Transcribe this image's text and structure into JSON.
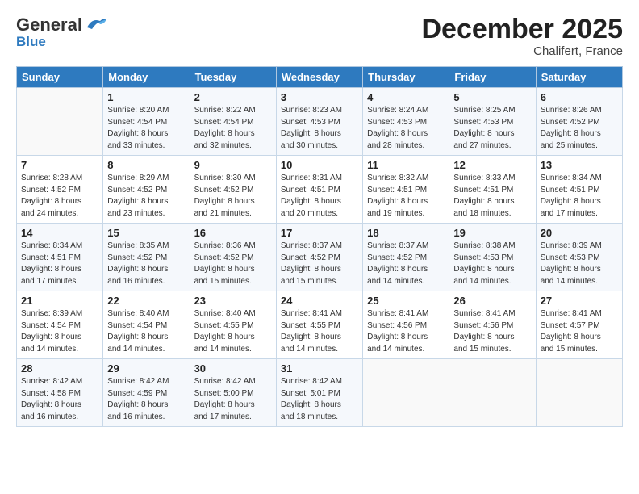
{
  "header": {
    "logo_line1": "General",
    "logo_line2": "Blue",
    "title": "December 2025",
    "subtitle": "Chalifert, France"
  },
  "days_of_week": [
    "Sunday",
    "Monday",
    "Tuesday",
    "Wednesday",
    "Thursday",
    "Friday",
    "Saturday"
  ],
  "weeks": [
    [
      {
        "num": "",
        "sunrise": "",
        "sunset": "",
        "daylight": ""
      },
      {
        "num": "1",
        "sunrise": "Sunrise: 8:20 AM",
        "sunset": "Sunset: 4:54 PM",
        "daylight": "Daylight: 8 hours and 33 minutes."
      },
      {
        "num": "2",
        "sunrise": "Sunrise: 8:22 AM",
        "sunset": "Sunset: 4:54 PM",
        "daylight": "Daylight: 8 hours and 32 minutes."
      },
      {
        "num": "3",
        "sunrise": "Sunrise: 8:23 AM",
        "sunset": "Sunset: 4:53 PM",
        "daylight": "Daylight: 8 hours and 30 minutes."
      },
      {
        "num": "4",
        "sunrise": "Sunrise: 8:24 AM",
        "sunset": "Sunset: 4:53 PM",
        "daylight": "Daylight: 8 hours and 28 minutes."
      },
      {
        "num": "5",
        "sunrise": "Sunrise: 8:25 AM",
        "sunset": "Sunset: 4:53 PM",
        "daylight": "Daylight: 8 hours and 27 minutes."
      },
      {
        "num": "6",
        "sunrise": "Sunrise: 8:26 AM",
        "sunset": "Sunset: 4:52 PM",
        "daylight": "Daylight: 8 hours and 25 minutes."
      }
    ],
    [
      {
        "num": "7",
        "sunrise": "Sunrise: 8:28 AM",
        "sunset": "Sunset: 4:52 PM",
        "daylight": "Daylight: 8 hours and 24 minutes."
      },
      {
        "num": "8",
        "sunrise": "Sunrise: 8:29 AM",
        "sunset": "Sunset: 4:52 PM",
        "daylight": "Daylight: 8 hours and 23 minutes."
      },
      {
        "num": "9",
        "sunrise": "Sunrise: 8:30 AM",
        "sunset": "Sunset: 4:52 PM",
        "daylight": "Daylight: 8 hours and 21 minutes."
      },
      {
        "num": "10",
        "sunrise": "Sunrise: 8:31 AM",
        "sunset": "Sunset: 4:51 PM",
        "daylight": "Daylight: 8 hours and 20 minutes."
      },
      {
        "num": "11",
        "sunrise": "Sunrise: 8:32 AM",
        "sunset": "Sunset: 4:51 PM",
        "daylight": "Daylight: 8 hours and 19 minutes."
      },
      {
        "num": "12",
        "sunrise": "Sunrise: 8:33 AM",
        "sunset": "Sunset: 4:51 PM",
        "daylight": "Daylight: 8 hours and 18 minutes."
      },
      {
        "num": "13",
        "sunrise": "Sunrise: 8:34 AM",
        "sunset": "Sunset: 4:51 PM",
        "daylight": "Daylight: 8 hours and 17 minutes."
      }
    ],
    [
      {
        "num": "14",
        "sunrise": "Sunrise: 8:34 AM",
        "sunset": "Sunset: 4:51 PM",
        "daylight": "Daylight: 8 hours and 17 minutes."
      },
      {
        "num": "15",
        "sunrise": "Sunrise: 8:35 AM",
        "sunset": "Sunset: 4:52 PM",
        "daylight": "Daylight: 8 hours and 16 minutes."
      },
      {
        "num": "16",
        "sunrise": "Sunrise: 8:36 AM",
        "sunset": "Sunset: 4:52 PM",
        "daylight": "Daylight: 8 hours and 15 minutes."
      },
      {
        "num": "17",
        "sunrise": "Sunrise: 8:37 AM",
        "sunset": "Sunset: 4:52 PM",
        "daylight": "Daylight: 8 hours and 15 minutes."
      },
      {
        "num": "18",
        "sunrise": "Sunrise: 8:37 AM",
        "sunset": "Sunset: 4:52 PM",
        "daylight": "Daylight: 8 hours and 14 minutes."
      },
      {
        "num": "19",
        "sunrise": "Sunrise: 8:38 AM",
        "sunset": "Sunset: 4:53 PM",
        "daylight": "Daylight: 8 hours and 14 minutes."
      },
      {
        "num": "20",
        "sunrise": "Sunrise: 8:39 AM",
        "sunset": "Sunset: 4:53 PM",
        "daylight": "Daylight: 8 hours and 14 minutes."
      }
    ],
    [
      {
        "num": "21",
        "sunrise": "Sunrise: 8:39 AM",
        "sunset": "Sunset: 4:54 PM",
        "daylight": "Daylight: 8 hours and 14 minutes."
      },
      {
        "num": "22",
        "sunrise": "Sunrise: 8:40 AM",
        "sunset": "Sunset: 4:54 PM",
        "daylight": "Daylight: 8 hours and 14 minutes."
      },
      {
        "num": "23",
        "sunrise": "Sunrise: 8:40 AM",
        "sunset": "Sunset: 4:55 PM",
        "daylight": "Daylight: 8 hours and 14 minutes."
      },
      {
        "num": "24",
        "sunrise": "Sunrise: 8:41 AM",
        "sunset": "Sunset: 4:55 PM",
        "daylight": "Daylight: 8 hours and 14 minutes."
      },
      {
        "num": "25",
        "sunrise": "Sunrise: 8:41 AM",
        "sunset": "Sunset: 4:56 PM",
        "daylight": "Daylight: 8 hours and 14 minutes."
      },
      {
        "num": "26",
        "sunrise": "Sunrise: 8:41 AM",
        "sunset": "Sunset: 4:56 PM",
        "daylight": "Daylight: 8 hours and 15 minutes."
      },
      {
        "num": "27",
        "sunrise": "Sunrise: 8:41 AM",
        "sunset": "Sunset: 4:57 PM",
        "daylight": "Daylight: 8 hours and 15 minutes."
      }
    ],
    [
      {
        "num": "28",
        "sunrise": "Sunrise: 8:42 AM",
        "sunset": "Sunset: 4:58 PM",
        "daylight": "Daylight: 8 hours and 16 minutes."
      },
      {
        "num": "29",
        "sunrise": "Sunrise: 8:42 AM",
        "sunset": "Sunset: 4:59 PM",
        "daylight": "Daylight: 8 hours and 16 minutes."
      },
      {
        "num": "30",
        "sunrise": "Sunrise: 8:42 AM",
        "sunset": "Sunset: 5:00 PM",
        "daylight": "Daylight: 8 hours and 17 minutes."
      },
      {
        "num": "31",
        "sunrise": "Sunrise: 8:42 AM",
        "sunset": "Sunset: 5:01 PM",
        "daylight": "Daylight: 8 hours and 18 minutes."
      },
      {
        "num": "",
        "sunrise": "",
        "sunset": "",
        "daylight": ""
      },
      {
        "num": "",
        "sunrise": "",
        "sunset": "",
        "daylight": ""
      },
      {
        "num": "",
        "sunrise": "",
        "sunset": "",
        "daylight": ""
      }
    ]
  ]
}
